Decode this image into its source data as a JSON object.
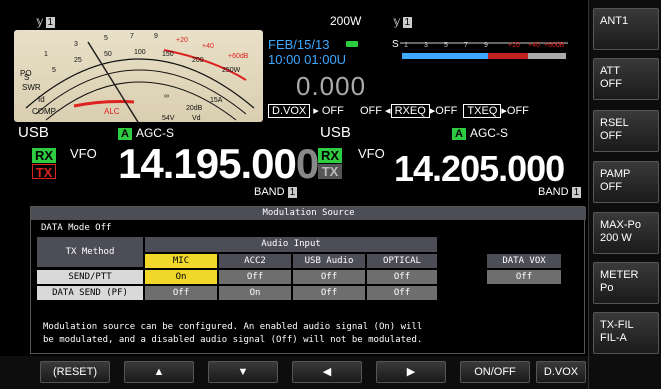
{
  "top": {
    "ant_left": "1",
    "ant_right": "1",
    "power": "200W",
    "date": "FEB/15/13",
    "time": "10:00 01:00U",
    "big_value": "0.000"
  },
  "meter": {
    "labels": [
      "S",
      "PO",
      "SWR",
      "Id",
      "COMP",
      "ALC"
    ],
    "scale_top": [
      "1",
      "3",
      "5",
      "7",
      "9",
      "+20",
      "+40",
      "+60dB"
    ],
    "scale_po": [
      "0",
      "5",
      "10",
      "25",
      "50",
      "100",
      "150",
      "200",
      "250W"
    ],
    "scale_swr": [
      "1",
      "1.5",
      "2",
      "3",
      "∞"
    ],
    "scale_id": [
      "0",
      "5",
      "10",
      "15A"
    ],
    "scale_comp": [
      "0",
      "10",
      "20dB"
    ],
    "scale_vd": [
      "0",
      "54V",
      "Vd"
    ]
  },
  "smeter": {
    "label": "S",
    "ticks": [
      "1",
      "3",
      "5",
      "7",
      "9",
      "+20",
      "+40",
      "+60dB"
    ]
  },
  "eq_line": {
    "dvox_label": "D.VOX",
    "dvox_value": "OFF",
    "off_label": "OFF",
    "rxeq_label": "RXEQ",
    "rxeq_value": "OFF",
    "txeq_label": "TXEQ",
    "txeq_value": "OFF"
  },
  "main_vfo": {
    "mode": "USB",
    "agc_badge": "A",
    "agc": "AGC-S",
    "rx": "RX",
    "tx": "TX",
    "vfo": "VFO",
    "freq_main": "14.195.00",
    "freq_last": "0",
    "band_label": "BAND",
    "band_num": "1"
  },
  "sub_vfo": {
    "mode": "USB",
    "agc_badge": "A",
    "agc": "AGC-S",
    "rx": "RX",
    "tx": "TX",
    "vfo": "VFO",
    "freq_main": "14.205.00",
    "freq_last": "0",
    "band_label": "BAND",
    "band_num": "1"
  },
  "panel": {
    "title": "Modulation Source",
    "subtitle": "DATA Mode Off",
    "tx_method_header": "TX Method",
    "audio_input_header": "Audio Input",
    "columns": [
      "MIC",
      "ACC2",
      "USB Audio",
      "OPTICAL"
    ],
    "data_vox_header": "DATA VOX",
    "rows": [
      {
        "label": "SEND/PTT",
        "values": [
          "On",
          "Off",
          "Off",
          "Off"
        ],
        "data_vox": "Off"
      },
      {
        "label": "DATA SEND (PF)",
        "values": [
          "Off",
          "On",
          "Off",
          "Off"
        ]
      }
    ],
    "description_line1": "Modulation source can be configured. An enabled audio signal (On) will",
    "description_line2": "be modulated, and a disabled audio signal (Off) will not be modulated."
  },
  "right_keys": [
    {
      "line1": "ANT1",
      "line2": ""
    },
    {
      "line1": "ATT",
      "line2": "OFF"
    },
    {
      "line1": "RSEL",
      "line2": "OFF"
    },
    {
      "line1": "PAMP",
      "line2": "OFF"
    },
    {
      "line1": "MAX-Po",
      "line2": "200 W"
    },
    {
      "line1": "METER",
      "line2": "Po"
    },
    {
      "line1": "TX-FIL",
      "line2": "FIL-A"
    }
  ],
  "bottom_keys": {
    "reset": "(RESET)",
    "up": "▲",
    "down": "▼",
    "left": "◀",
    "right": "▶",
    "onoff": "ON/OFF",
    "dvox": "D.VOX"
  },
  "colors": {
    "accent_green": "#2ecc40",
    "accent_blue": "#3fa9ff",
    "on_yellow": "#f0d72a",
    "header_gray": "#4d4d57",
    "off_gray": "#6e6e6e"
  }
}
